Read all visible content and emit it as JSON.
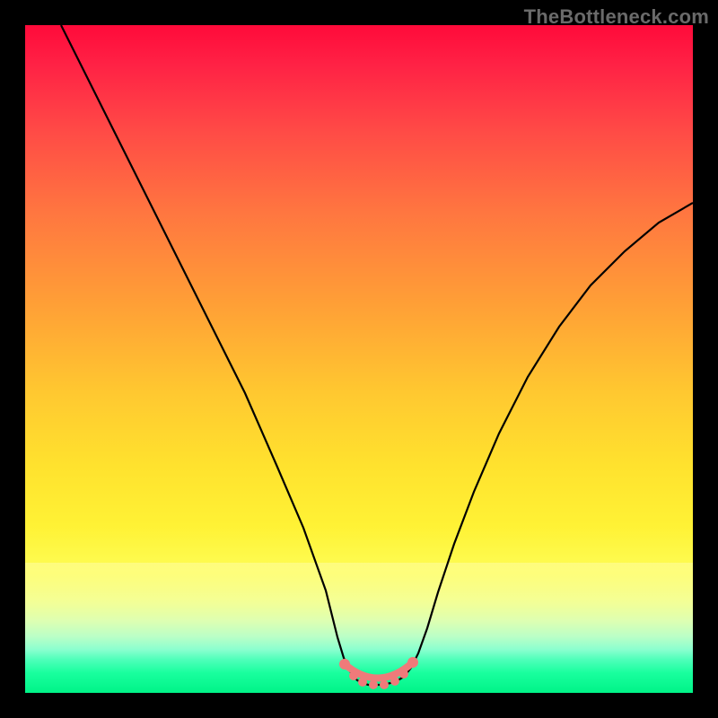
{
  "watermark": "TheBottleneck.com",
  "colors": {
    "background": "#000000",
    "watermark_text": "#6a6a6a",
    "curve_stroke": "#000000",
    "valley_marker": "#ef7a7a",
    "gradient_stops": [
      "#ff0a3a",
      "#ff4b46",
      "#ffa036",
      "#ffe22e",
      "#fdfd55",
      "#bcffc6",
      "#19ff9e",
      "#00f387"
    ]
  },
  "chart_data": {
    "type": "line",
    "title": "",
    "xlabel": "",
    "ylabel": "",
    "ylim": [
      0,
      100
    ],
    "xlim": [
      0,
      100
    ],
    "x": [
      0,
      5,
      10,
      15,
      20,
      25,
      30,
      35,
      40,
      45,
      47,
      50,
      53,
      55,
      58,
      60,
      65,
      70,
      75,
      80,
      85,
      90,
      95,
      100
    ],
    "values": [
      100,
      90,
      80,
      70,
      60,
      50,
      40,
      30,
      20,
      8,
      3,
      1,
      1,
      1,
      3,
      8,
      18,
      27,
      36,
      44,
      51,
      57,
      62,
      67
    ],
    "valley_range_x": [
      46,
      58
    ],
    "valley_value": 1
  }
}
